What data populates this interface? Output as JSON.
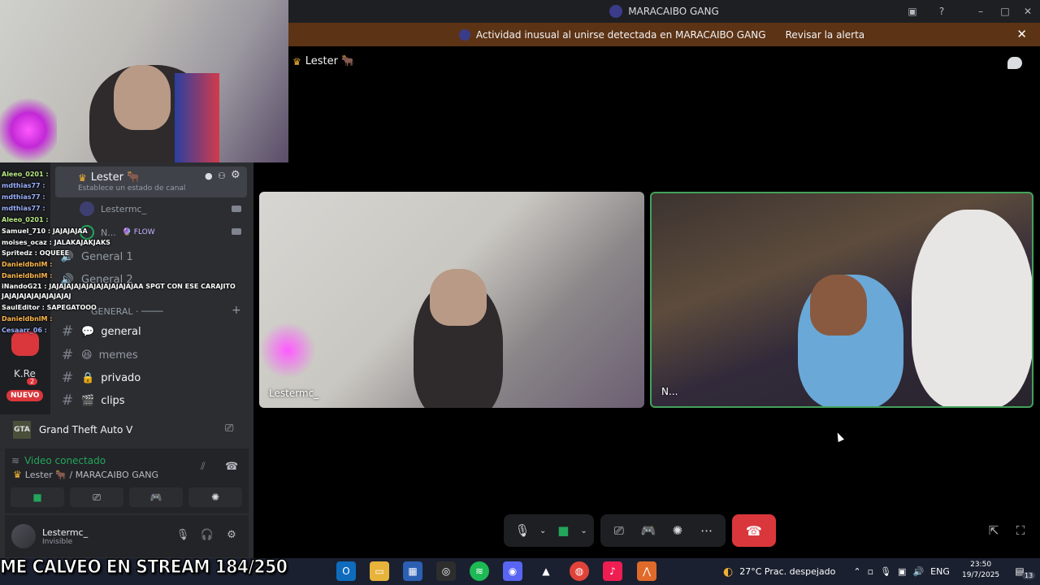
{
  "window": {
    "title": "MARACAIBO GANG"
  },
  "alert": {
    "message": "Actividad inusual al unirse detectada en MARACAIBO GANG",
    "action": "Revisar la alerta"
  },
  "stage": {
    "channel_name": "Lester 🐂",
    "tiles": [
      {
        "name": "Lestermc_",
        "speaking": false
      },
      {
        "name": "N...",
        "speaking": true
      }
    ]
  },
  "sidebar": {
    "active_voice_channel": "Lester 🐂",
    "active_voice_status": "Establece un estado de canal",
    "members": [
      {
        "name": "Lestermc_"
      },
      {
        "name": "N...",
        "tag": "🔮 FLOW"
      }
    ],
    "voice_channels": [
      "General 1",
      "General 2"
    ],
    "category": "GENERAL · ────",
    "text_channels": [
      {
        "emoji": "💬",
        "name": "general",
        "unread": true
      },
      {
        "emoji": "😆",
        "name": "memes",
        "unread": false
      },
      {
        "emoji": "🔒",
        "name": "privado",
        "unread": true
      },
      {
        "emoji": "🎬",
        "name": "clips",
        "unread": true
      }
    ],
    "rail": {
      "server_abbrev": "K.Re",
      "badge": "2",
      "new_label": "NUEVO"
    }
  },
  "stream_chat": [
    "Aleeo_0201 :",
    "mdthias77 :",
    "mdthias77 :",
    "mdthias77 :",
    "Aleeo_0201 :",
    "Samuel_710 : JAJAJAJAA",
    "moises_ocaz : JALAKAJAKJAKS",
    "Spritedz : OQUEEE",
    "DanieldbnlM :",
    "DanieldbnlM :",
    "iNandoG21 : JAJAJAJAJAJAJAJAJAJAJAJAA SPGT CON ESE CARAJITO",
    "JAJAJAJAJAJAJAJAJAJ",
    "SaulEditor : SAPEGATOOO",
    "DanieldbnlM :",
    "Cesaarr_06 :"
  ],
  "activity": {
    "game": "Grand Theft Auto V",
    "game_icon_text": "GTA"
  },
  "voice_panel": {
    "status": "Video conectado",
    "location": "Lester 🐂 / MARACAIBO GANG"
  },
  "user": {
    "name": "Lestermc_",
    "status": "Invisible"
  },
  "stream_overlay_text": "ME CALVEO EN STREAM 184/250",
  "taskbar": {
    "weather": "27°C  Prac. despejado",
    "language": "ENG",
    "time": "23:50",
    "date": "19/7/2025",
    "notifications": "13"
  },
  "colors": {
    "accent_green": "#23a55a",
    "hangup_red": "#da373c",
    "alert_bg": "#5c3315",
    "speaking_border": "#43a25a"
  }
}
